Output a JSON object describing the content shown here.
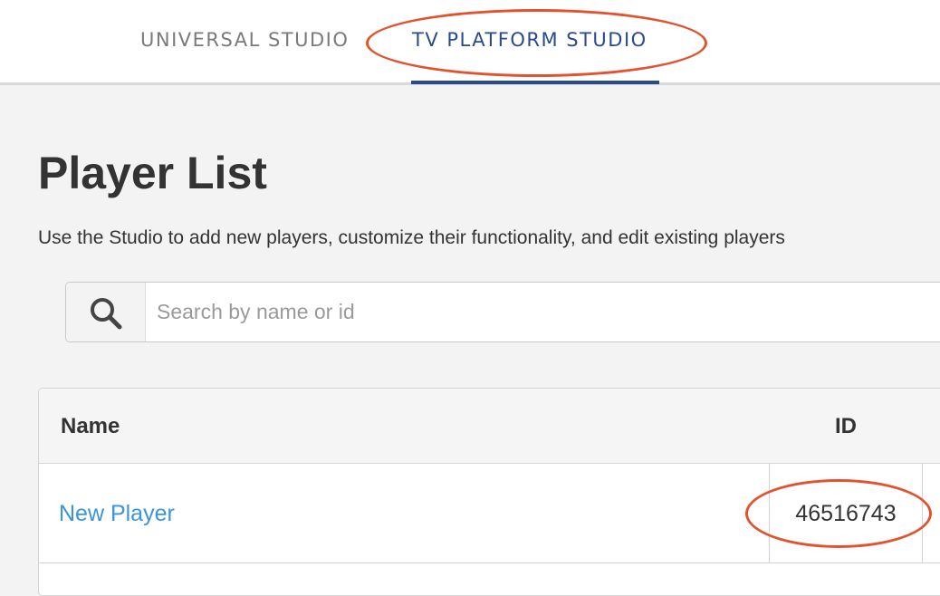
{
  "nav": {
    "tabs": [
      {
        "label": "UNIVERSAL STUDIO",
        "active": false
      },
      {
        "label": "TV PLATFORM STUDIO",
        "active": true
      }
    ],
    "active_color": "#2a4a8e",
    "inactive_color": "#7a7a7a"
  },
  "page": {
    "title": "Player List",
    "subtitle": "Use the Studio to add new players, customize their functionality, and edit existing players"
  },
  "search": {
    "placeholder": "Search by name or id",
    "value": "",
    "icon": "search-icon"
  },
  "table": {
    "columns": [
      "Name",
      "ID"
    ],
    "rows": [
      {
        "name": "New Player",
        "id": "46516743"
      }
    ]
  },
  "colors": {
    "annotation": "#e3522f",
    "link": "#3a94e0",
    "background": "#f3f3f3"
  }
}
